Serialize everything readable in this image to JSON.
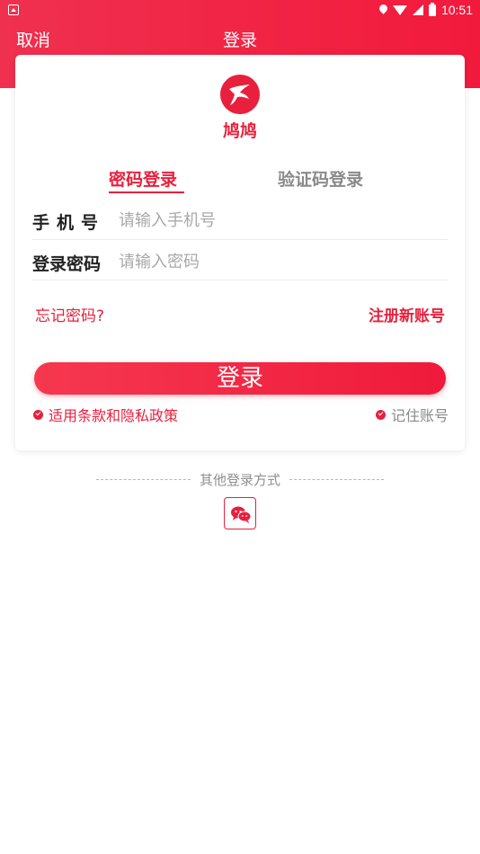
{
  "status_bar": {
    "time": "10:51",
    "icons": [
      "notification-icon",
      "location-icon",
      "wifi-icon",
      "signal-icon",
      "battery-icon"
    ]
  },
  "nav": {
    "cancel_label": "取消",
    "title": "登录"
  },
  "brand": {
    "name": "鸠鸠",
    "logo_icon": "swallow-logo-icon"
  },
  "tabs": [
    {
      "label": "密码登录",
      "active": true
    },
    {
      "label": "验证码登录",
      "active": false
    }
  ],
  "form": {
    "phone_label": "手机号",
    "phone_placeholder": "请输入手机号",
    "password_label": "登录密码",
    "password_placeholder": "请输入密码"
  },
  "links": {
    "forgot": "忘记密码?",
    "register": "注册新账号"
  },
  "login_button_label": "登录",
  "agreement": {
    "terms_label": "适用条款和隐私政策",
    "terms_checked": true,
    "remember_label": "记住账号",
    "remember_checked": true
  },
  "other_login": {
    "title": "其他登录方式",
    "wechat_icon": "wechat-icon"
  },
  "colors": {
    "accent": "#e8203d",
    "header": "#f21a3c",
    "muted": "#8a8a8a"
  }
}
